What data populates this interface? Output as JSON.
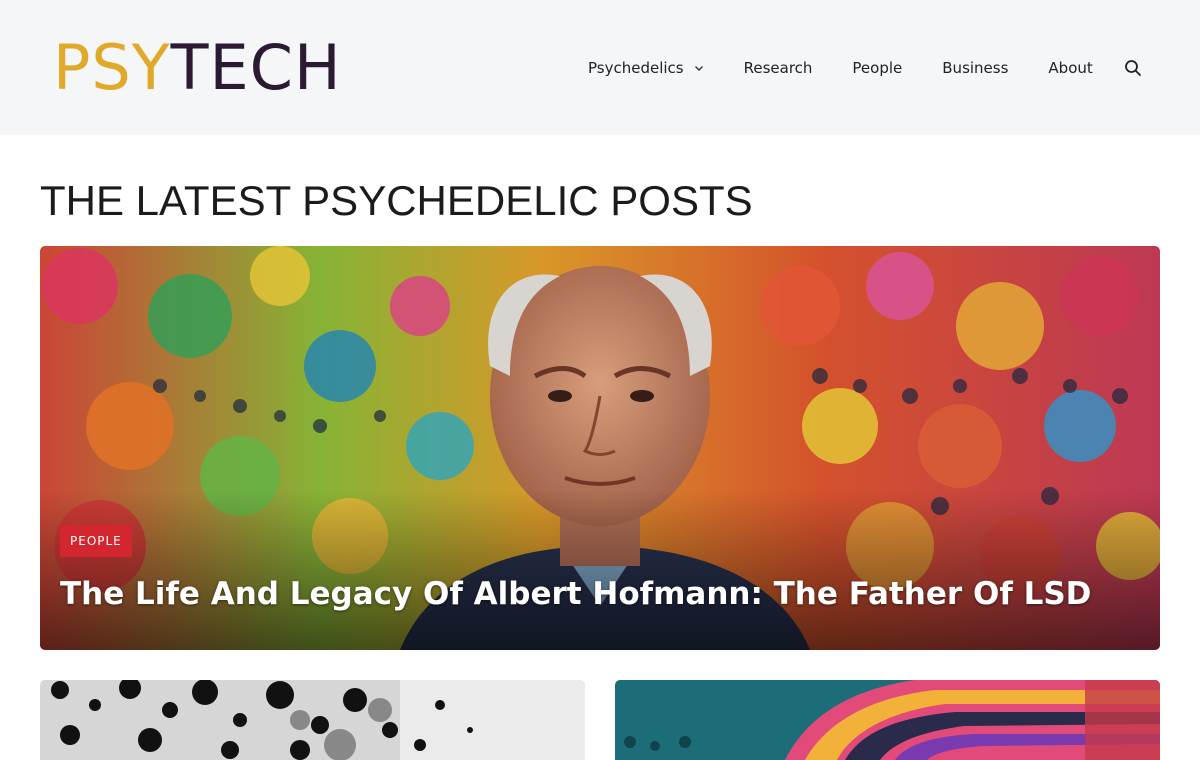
{
  "header": {
    "logo_part1": "PSY",
    "logo_part2": "TECH"
  },
  "nav": {
    "items": [
      {
        "label": "Psychedelics",
        "has_dropdown": true
      },
      {
        "label": "Research"
      },
      {
        "label": "People"
      },
      {
        "label": "Business"
      },
      {
        "label": "About"
      }
    ],
    "search_icon": "search-icon"
  },
  "main": {
    "section_title": "THE LATEST PSYCHEDELIC POSTS",
    "featured": {
      "category": "PEOPLE",
      "title": "The Life And Legacy Of Albert Hofmann: The Father Of LSD"
    }
  },
  "colors": {
    "logo_accent": "#e0a92a",
    "logo_dark": "#2a1b33",
    "badge": "#d3262f",
    "header_bg": "#f5f6f8"
  }
}
